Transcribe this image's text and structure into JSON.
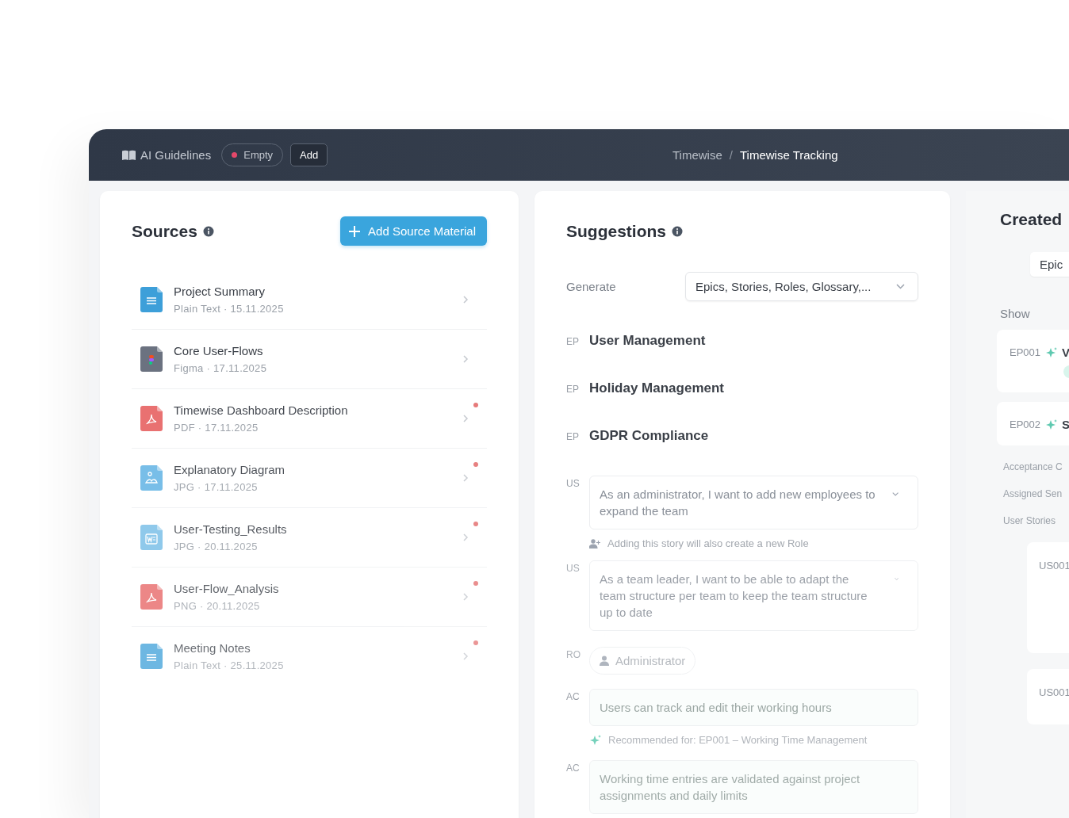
{
  "header": {
    "guidelines_label": "AI Guidelines",
    "status": {
      "label": "Empty",
      "color": "#e5486a"
    },
    "add_button": "Add",
    "breadcrumb": [
      "Timewise",
      "Timewise Tracking"
    ],
    "breadcrumb_separator": "/"
  },
  "sources": {
    "title": "Sources",
    "add_button": "Add Source Material",
    "items": [
      {
        "kind": "text",
        "name": "Project Summary",
        "meta": "Plain Text · 15.11.2025",
        "unread": false
      },
      {
        "kind": "figma",
        "name": "Core User-Flows",
        "meta": "Figma · 17.11.2025",
        "unread": false
      },
      {
        "kind": "pdf",
        "name": "Timewise Dashboard Description",
        "meta": "PDF · 17.11.2025",
        "unread": true
      },
      {
        "kind": "image",
        "name": "Explanatory Diagram",
        "meta": "JPG · 17.11.2025",
        "unread": true
      },
      {
        "kind": "word",
        "name": "User-Testing_Results",
        "meta": "JPG · 20.11.2025",
        "unread": true
      },
      {
        "kind": "pdf",
        "name": "User-Flow_Analysis",
        "meta": "PNG · 20.11.2025",
        "unread": true
      },
      {
        "kind": "text",
        "name": "Meeting Notes",
        "meta": "Plain Text · 25.11.2025",
        "unread": true
      }
    ]
  },
  "suggestions": {
    "title": "Suggestions",
    "generate_label": "Generate",
    "generate_value": "Epics, Stories, Roles, Glossary,...",
    "items": [
      {
        "kind": "epic",
        "tag": "EP",
        "text": "User Management"
      },
      {
        "kind": "epic",
        "tag": "EP",
        "text": "Holiday Management"
      },
      {
        "kind": "epic",
        "tag": "EP",
        "text": "GDPR Compliance"
      },
      {
        "kind": "story",
        "tag": "US",
        "text": "As an administrator, I want to add new employees to expand the team",
        "note": {
          "kind": "role",
          "text": "Adding this story will also create a new Role"
        }
      },
      {
        "kind": "story",
        "tag": "US",
        "text": "As a team leader, I want to be able to adapt the team structure per team to keep the team structure up to date"
      },
      {
        "kind": "role",
        "tag": "RO",
        "text": "Administrator"
      },
      {
        "kind": "criterion",
        "tag": "AC",
        "text": "Users can track and edit their working hours",
        "note": {
          "kind": "recommendation",
          "text": "Recommended for: EP001 – Working Time Management"
        }
      },
      {
        "kind": "criterion",
        "tag": "AC",
        "text": "Working time entries are validated against project assignments and daily limits"
      }
    ]
  },
  "created": {
    "title": "Created",
    "filter_value": "Epic",
    "show_label": "Show",
    "epics": [
      {
        "id": "EP001",
        "title": "V"
      },
      {
        "id": "EP002",
        "title": "S",
        "details": [
          "Acceptance C",
          "Assigned Sen",
          "User Stories"
        ],
        "stories": [
          "US001",
          "US001"
        ]
      }
    ]
  }
}
